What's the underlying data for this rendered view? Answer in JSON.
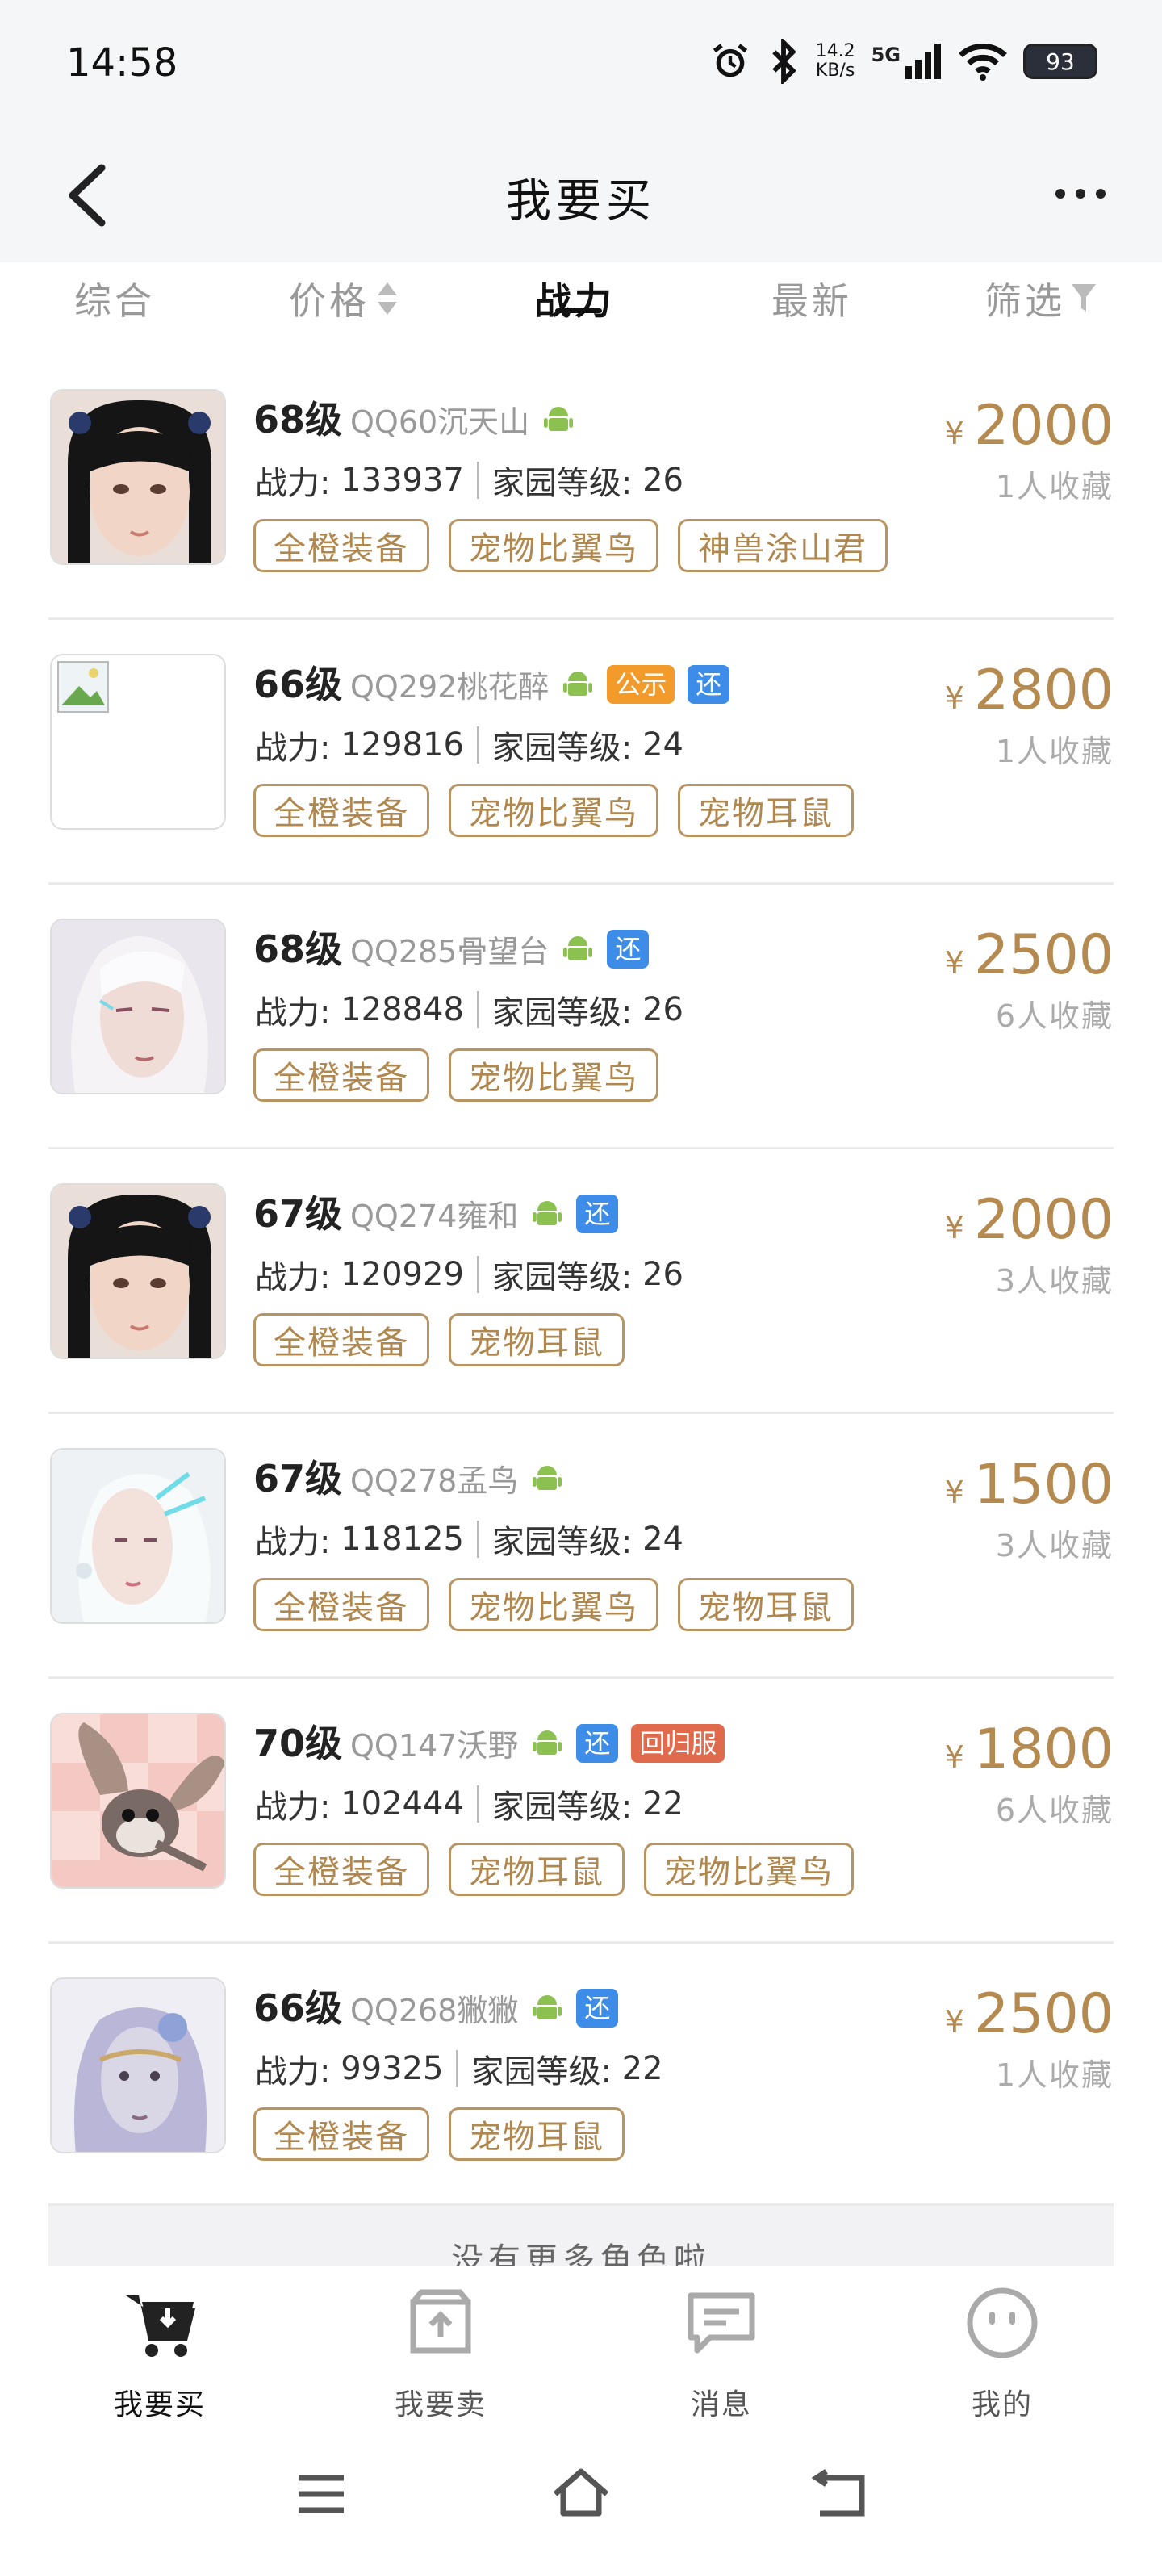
{
  "status": {
    "time": "14:58",
    "speed_value": "14.2",
    "speed_unit": "KB/s",
    "network": "5G",
    "battery": "93"
  },
  "header": {
    "title": "我要买"
  },
  "sort": {
    "items": [
      "综合",
      "价格",
      "战力",
      "最新",
      "筛选"
    ],
    "active": "战力"
  },
  "listings": [
    {
      "level": "68级",
      "server": "QQ60沉天山",
      "badges": [],
      "power_label": "战力:",
      "power": "133937",
      "home_label": "家园等级:",
      "home_level": "26",
      "tags": [
        "全橙装备",
        "宠物比翼鸟",
        "神兽涂山君"
      ],
      "currency": "¥",
      "price": "2000",
      "favorites": "1人收藏"
    },
    {
      "level": "66级",
      "server": "QQ292桃花醉",
      "badges": [
        "公示",
        "还"
      ],
      "power_label": "战力:",
      "power": "129816",
      "home_label": "家园等级:",
      "home_level": "24",
      "tags": [
        "全橙装备",
        "宠物比翼鸟",
        "宠物耳鼠"
      ],
      "currency": "¥",
      "price": "2800",
      "favorites": "1人收藏"
    },
    {
      "level": "68级",
      "server": "QQ285骨望台",
      "badges": [
        "还"
      ],
      "power_label": "战力:",
      "power": "128848",
      "home_label": "家园等级:",
      "home_level": "26",
      "tags": [
        "全橙装备",
        "宠物比翼鸟"
      ],
      "currency": "¥",
      "price": "2500",
      "favorites": "6人收藏"
    },
    {
      "level": "67级",
      "server": "QQ274雍和",
      "badges": [
        "还"
      ],
      "power_label": "战力:",
      "power": "120929",
      "home_label": "家园等级:",
      "home_level": "26",
      "tags": [
        "全橙装备",
        "宠物耳鼠"
      ],
      "currency": "¥",
      "price": "2000",
      "favorites": "3人收藏"
    },
    {
      "level": "67级",
      "server": "QQ278孟鸟",
      "badges": [],
      "power_label": "战力:",
      "power": "118125",
      "home_label": "家园等级:",
      "home_level": "24",
      "tags": [
        "全橙装备",
        "宠物比翼鸟",
        "宠物耳鼠"
      ],
      "currency": "¥",
      "price": "1500",
      "favorites": "3人收藏"
    },
    {
      "level": "70级",
      "server": "QQ147沃野",
      "badges": [
        "还",
        "回归服"
      ],
      "power_label": "战力:",
      "power": "102444",
      "home_label": "家园等级:",
      "home_level": "22",
      "tags": [
        "全橙装备",
        "宠物耳鼠",
        "宠物比翼鸟"
      ],
      "currency": "¥",
      "price": "1800",
      "favorites": "6人收藏"
    },
    {
      "level": "66级",
      "server": "QQ268獙獙",
      "badges": [
        "还"
      ],
      "power_label": "战力:",
      "power": "99325",
      "home_label": "家园等级:",
      "home_level": "22",
      "tags": [
        "全橙装备",
        "宠物耳鼠"
      ],
      "currency": "¥",
      "price": "2500",
      "favorites": "1人收藏"
    }
  ],
  "footer_note": "没有更多角色啦",
  "nav": {
    "items": [
      "我要买",
      "我要卖",
      "消息",
      "我的"
    ],
    "active": "我要买"
  },
  "colors": {
    "accent_gold": "#b48a50",
    "badge_blue": "#3d8de8",
    "badge_orange": "#f29b2b",
    "badge_red": "#e06a4c",
    "android_green": "#8cc152"
  },
  "icons": [
    "back-arrow-icon",
    "more-dots-icon",
    "sort-arrows-icon",
    "filter-funnel-icon",
    "android-icon",
    "cart-icon",
    "sell-box-icon",
    "message-icon",
    "smile-face-icon",
    "alarm-icon",
    "bluetooth-icon",
    "signal-icon",
    "wifi-icon",
    "battery-icon",
    "menu-lines-icon",
    "home-icon",
    "return-icon"
  ]
}
